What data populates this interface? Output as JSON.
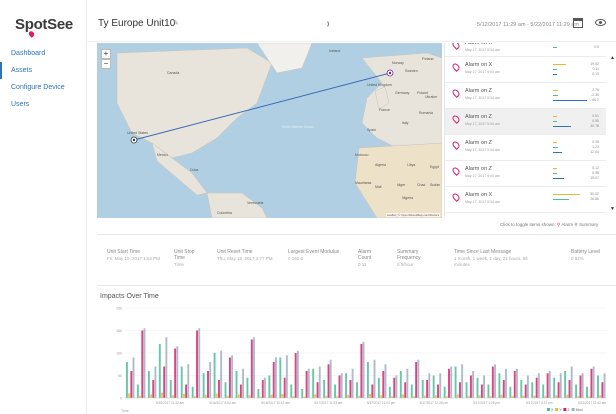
{
  "brand": {
    "logo_text": "SpotSee",
    "accent": "#d6226a",
    "link_color": "#2c75b8"
  },
  "nav": {
    "items": [
      "Dashboard",
      "Assets",
      "Configure Device",
      "Users"
    ],
    "active_index": 1
  },
  "header": {
    "title": "Ty Europe Unit10",
    "date_range": "5/12/2017 11:29 am  -  5/22/2017 11:29 am",
    "icons": [
      "edit-icon",
      "calendar-icon",
      "eye-icon"
    ]
  },
  "map": {
    "zoom_in_label": "+",
    "zoom_out_label": "−",
    "attribution": "Leaflet | © OpenStreetMap contributors",
    "labels": [
      "Canada",
      "United States",
      "Mexico",
      "Cuba",
      "Venezuela",
      "Colombia",
      "North Atlantic Ocean",
      "Iceland",
      "Finland",
      "Sweden",
      "Norway",
      "United Kingdom",
      "Germany",
      "Poland",
      "France",
      "Spain",
      "Italy",
      "Romania",
      "Ukraine",
      "Morocco",
      "Algeria",
      "Libya",
      "Egypt",
      "Mali",
      "Niger",
      "Chad",
      "Mauritania",
      "Nigeria",
      "Sudan"
    ]
  },
  "alarms": [
    {
      "title": "Alarm on X",
      "date": "May 17, 2017 9:04 am",
      "values": [
        "11.27",
        "0.5"
      ]
    },
    {
      "title": "Alarm on X",
      "date": "May 17, 2017 9:04 am",
      "values": [
        "19.52",
        "0.11",
        "0.13"
      ]
    },
    {
      "title": "Alarm on Z",
      "date": "May 17, 2017 9:04 am",
      "values": [
        "2.76",
        "-2.35",
        "66.2"
      ]
    },
    {
      "title": "Alarm on Z",
      "date": "May 17, 2017 9:04 am",
      "values": [
        "0.51",
        "0.55",
        "30.78"
      ]
    },
    {
      "title": "Alarm on Z",
      "date": "May 17, 2017 9:04 am",
      "values": [
        "0.25",
        "1.23",
        "12.04"
      ]
    },
    {
      "title": "Alarm on Z",
      "date": "May 17, 2017 9:04 am",
      "values": [
        "0.12",
        "0.38",
        "15.07"
      ]
    },
    {
      "title": "Alarm on X",
      "date": "May 17, 2017 9:04 am",
      "values": [
        "50.52",
        "26.86"
      ]
    }
  ],
  "toggle": {
    "text": "Click to toggle items shown:",
    "alarm_label": "Alarm",
    "summary_label": "Summary"
  },
  "stats": [
    {
      "label": "Unit Start Time",
      "value": "Fri, May 19, 2017 1:52 PM"
    },
    {
      "label": "Unit Stop Time",
      "value": "Time"
    },
    {
      "label": "Unit Reset Time",
      "value": "Thu, May 18, 2017 3:77 PM"
    },
    {
      "label": "Largest Event Modulus",
      "value": "0 192.6"
    },
    {
      "label": "Alarm Count",
      "value": "0 11"
    },
    {
      "label": "Summary Frequency",
      "value": "0 5/hour"
    },
    {
      "label": "Time Since Last Message",
      "value": "1 month, 1 week, 1 day, 21 hours, 55 minutes"
    },
    {
      "label": "Battery Level",
      "value": "0 92%"
    }
  ],
  "chart_data": {
    "type": "bar",
    "title": "Impacts Over Time",
    "ylabel": "",
    "y_ticks": [
      "200",
      "150",
      "100",
      "50",
      "0"
    ],
    "xlabel": "Time",
    "x_ticks": [
      "5/15/2017 11:42 am",
      "5/16/2017 8:02 am",
      "5/16/2017 10:42 am",
      "5/17/2017 11:33 am",
      "5/17/2017 12:04 pm",
      "5/17/2017 12:38 pm",
      "5/17/2017 1:25 pm",
      "5/17/2017 4:37 pm",
      "5/22/2017 11:42 am"
    ],
    "legend": [
      {
        "name": "X",
        "color": "#4dbd9a"
      },
      {
        "name": "Y",
        "color": "#e8b830"
      },
      {
        "name": "Z",
        "color": "#d6226a"
      },
      {
        "name": "Mod",
        "color": "#9fb0c4"
      }
    ],
    "ylim": [
      0,
      200
    ],
    "series": [
      {
        "name": "X",
        "values": [
          80,
          30,
          60,
          120,
          40,
          70,
          25,
          55,
          100,
          35,
          60,
          45,
          20,
          50,
          90,
          30,
          20,
          65,
          40,
          30,
          55,
          35,
          80,
          45,
          25,
          60,
          30,
          40,
          50,
          25,
          70,
          35,
          45,
          30,
          55,
          25,
          40,
          35,
          30,
          45,
          60,
          30,
          25,
          50
        ]
      },
      {
        "name": "Y",
        "values": [
          10,
          5,
          8,
          12,
          6,
          9,
          4,
          7,
          10,
          5,
          8,
          6,
          3,
          7,
          9,
          4,
          3,
          8,
          5,
          4,
          7,
          5,
          9,
          6,
          4,
          8,
          4,
          5,
          6,
          4,
          8,
          5,
          6,
          4,
          7,
          4,
          5,
          5,
          4,
          6,
          7,
          4,
          4,
          6
        ]
      },
      {
        "name": "Z",
        "values": [
          60,
          150,
          40,
          70,
          110,
          30,
          150,
          60,
          40,
          90,
          30,
          130,
          40,
          80,
          45,
          100,
          60,
          35,
          75,
          50,
          40,
          120,
          30,
          60,
          45,
          35,
          80,
          40,
          30,
          65,
          35,
          50,
          30,
          70,
          40,
          60,
          30,
          45,
          55,
          35,
          40,
          50,
          65,
          35
        ]
      },
      {
        "name": "Mod",
        "values": [
          90,
          155,
          70,
          135,
          115,
          75,
          155,
          80,
          105,
          95,
          65,
          135,
          45,
          90,
          95,
          105,
          65,
          70,
          85,
          55,
          65,
          125,
          85,
          75,
          50,
          65,
          85,
          55,
          55,
          70,
          75,
          60,
          50,
          75,
          65,
          65,
          50,
          55,
          60,
          55,
          70,
          55,
          70,
          55
        ]
      }
    ]
  }
}
